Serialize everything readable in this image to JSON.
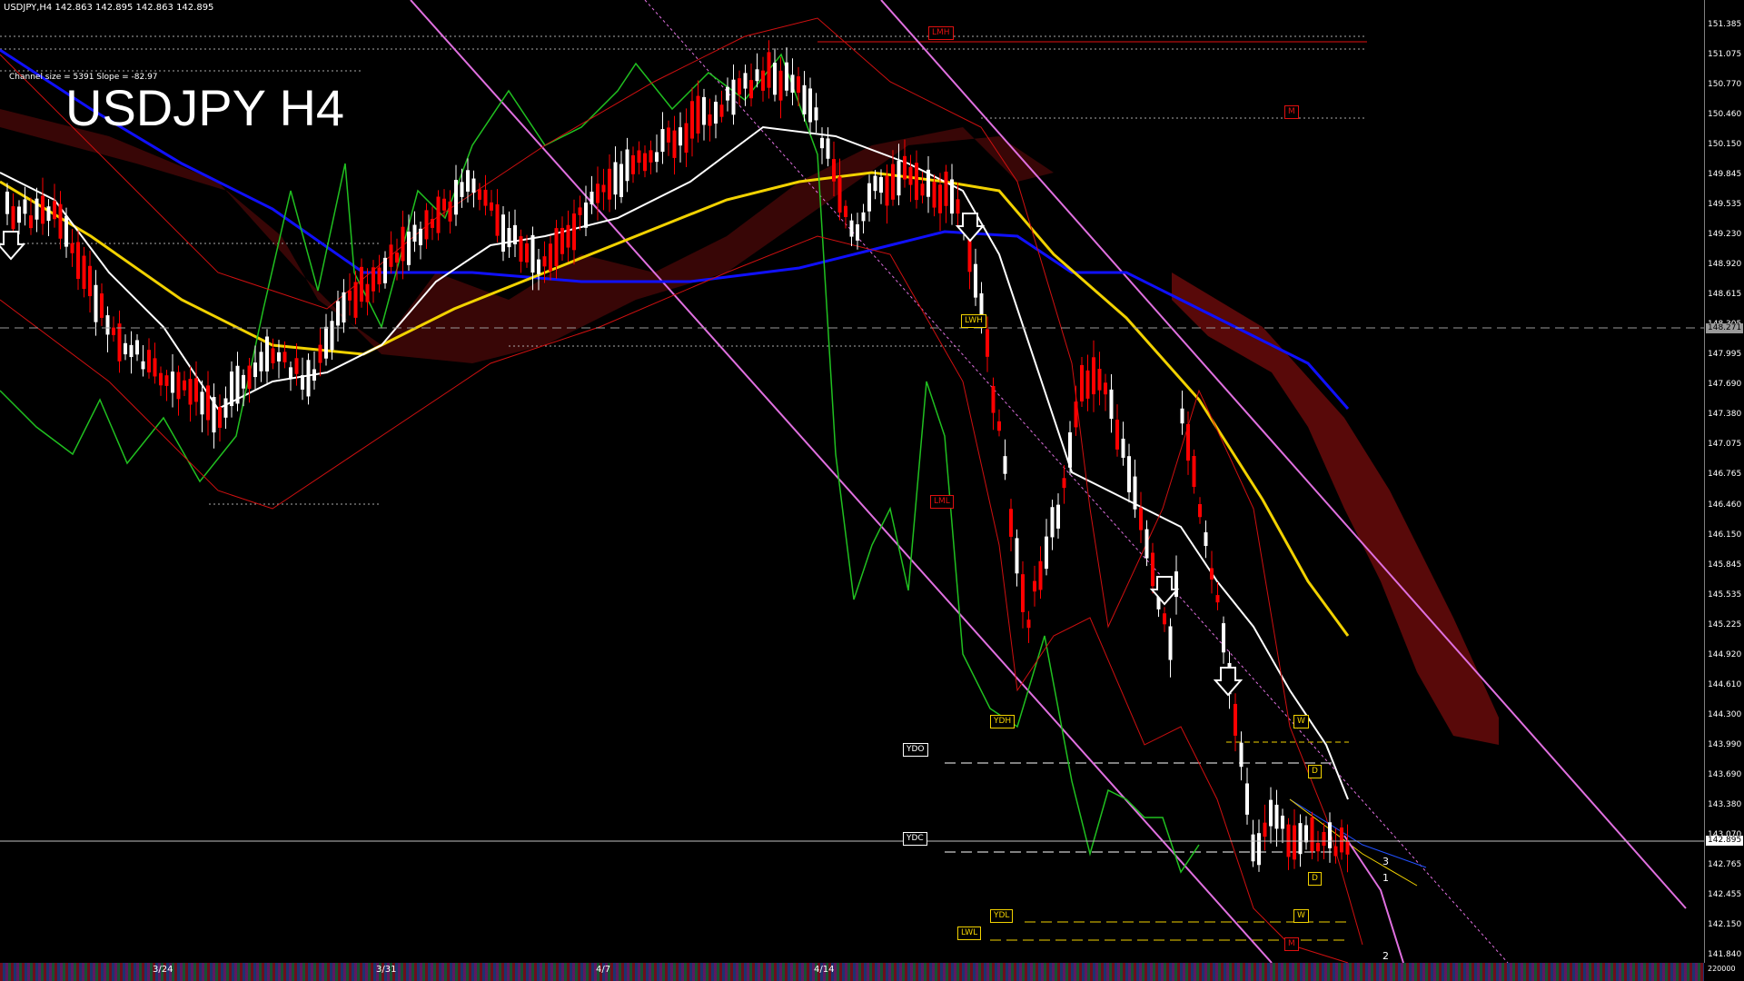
{
  "header": {
    "info_line": "USDJPY,H4  142.863 142.895 142.863 142.895",
    "channel_info": "Channel size = 5391 Slope = -82.97",
    "big_title": "USDJPY H4"
  },
  "price_axis": {
    "ticks": [
      "151.385",
      "151.075",
      "150.770",
      "150.460",
      "150.150",
      "149.845",
      "149.535",
      "149.230",
      "148.920",
      "148.615",
      "148.305",
      "147.995",
      "147.690",
      "147.380",
      "147.075",
      "146.765",
      "146.460",
      "146.150",
      "145.845",
      "145.535",
      "145.225",
      "144.920",
      "144.610",
      "144.300",
      "143.990",
      "143.690",
      "143.380",
      "143.070",
      "142.765",
      "142.455",
      "142.150",
      "141.840"
    ],
    "current_price": "142.895",
    "level_price": "148.271",
    "bottom_label": "220000"
  },
  "time_axis": {
    "labels": [
      "3/24",
      "3/31",
      "4/7",
      "4/14"
    ]
  },
  "level_tags": {
    "lmh": "LMH",
    "m_top": "M",
    "lwh": "LWH",
    "lml": "LML",
    "ydh": "YDH",
    "ydo": "YDO",
    "ydc": "YDC",
    "ydl": "YDL",
    "lwl": "LWL",
    "w_top": "W",
    "d_top": "D",
    "d_bottom": "D",
    "w_bottom": "W",
    "m_bottom": "M"
  },
  "projection_labels": {
    "label_3": "3",
    "label_1": "1",
    "label_2": "2"
  },
  "colors": {
    "background": "#000000",
    "bull_candle": "#ffffff",
    "bear_candle": "#ff0000",
    "ma_blue": "#1010ff",
    "ma_yellow": "#f2d200",
    "ma_white": "#ffffff",
    "channel_pink": "#e070e0",
    "rsi_green": "#20c020",
    "bollinger_red": "#d01010",
    "cloud_red": "#a01010"
  }
}
